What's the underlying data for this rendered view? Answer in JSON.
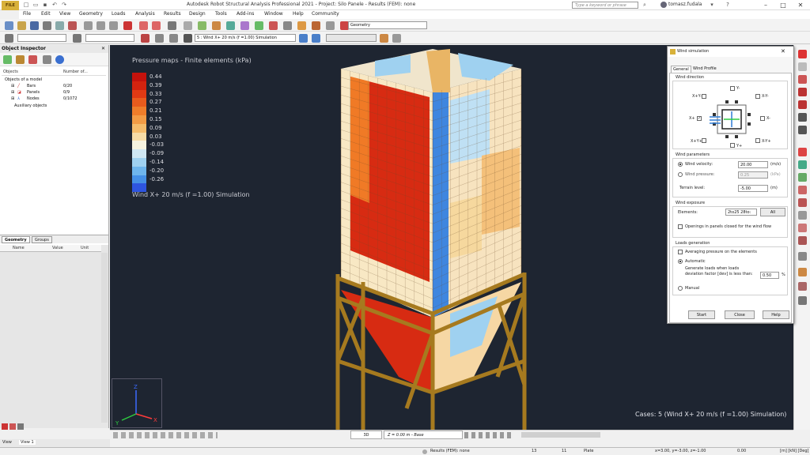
{
  "app": {
    "icon_label": "FILE",
    "title": "Autodesk Robot Structural Analysis Professional 2021 - Project: Silo Panele - Results (FEM): none",
    "search_placeholder": "Type a keyword or phrase",
    "user": "tomasz.fudala"
  },
  "menu": [
    "File",
    "Edit",
    "View",
    "Geometry",
    "Loads",
    "Analysis",
    "Results",
    "Design",
    "Tools",
    "Add-ins",
    "Window",
    "Help",
    "Community"
  ],
  "toolbar": {
    "case_select": "5 : Wind X+ 20 m/s (f =1.00) Simulation",
    "layout_select": "Geometry"
  },
  "inspector": {
    "title": "Object Inspector",
    "columns": [
      "Objects",
      "Number of..."
    ],
    "root": "Objects of a model",
    "items": [
      {
        "label": "Bars",
        "count": "0/20"
      },
      {
        "label": "Panels",
        "count": "0/9"
      },
      {
        "label": "Nodes",
        "count": "0/1072"
      }
    ],
    "auxiliary": "Auxiliary objects",
    "tabs": [
      "Geometry",
      "Groups"
    ]
  },
  "properties": {
    "columns": [
      "Name",
      "Value",
      "Unit"
    ]
  },
  "viewport": {
    "legend_title": "Pressure maps - Finite elements (kPa)",
    "legend": [
      {
        "value": "0.44",
        "color": "#c4120c"
      },
      {
        "value": "0.39",
        "color": "#d3230f"
      },
      {
        "value": "0.33",
        "color": "#e03a14"
      },
      {
        "value": "0.27",
        "color": "#e85b1d"
      },
      {
        "value": "0.21",
        "color": "#ef7d2a"
      },
      {
        "value": "0.15",
        "color": "#f39c45"
      },
      {
        "value": "0.09",
        "color": "#f6bd6c"
      },
      {
        "value": "0.03",
        "color": "#f7dca6"
      },
      {
        "value": "-0.03",
        "color": "#f6f3df"
      },
      {
        "value": "-0.09",
        "color": "#cfe7f3"
      },
      {
        "value": "-0.14",
        "color": "#9fd1f0"
      },
      {
        "value": "-0.20",
        "color": "#6eb5ec"
      },
      {
        "value": "-0.26",
        "color": "#4590e6"
      },
      {
        "value": "",
        "color": "#2e55e0"
      }
    ],
    "simulation_label": "Wind X+ 20 m/s (f =1.00) Simulation",
    "cases_label": "Cases: 5 (Wind X+ 20 m/s (f =1.00) Simulation)",
    "axes": {
      "x": "X",
      "y": "Y",
      "z": "Z"
    }
  },
  "dialog": {
    "title": "Wind simulation",
    "tabs": [
      "General",
      "Wind Profile"
    ],
    "direction": {
      "group": "Wind direction",
      "labels": [
        "Y-",
        "X+Y-",
        "X-Y-",
        "X+",
        "X-",
        "X+Y+",
        "X-Y+",
        "Y+"
      ],
      "checked": "X+"
    },
    "parameters": {
      "group": "Wind parameters",
      "velocity_label": "Wind velocity:",
      "velocity_value": "20.00",
      "velocity_unit": "(m/s)",
      "pressure_label": "Wind pressure:",
      "pressure_value": "0.25",
      "pressure_unit": "(kPa)",
      "terrain_label": "Terrain level:",
      "terrain_value": "-5.00",
      "terrain_unit": "(m)"
    },
    "exposure": {
      "group": "Wind exposure",
      "elements_label": "Elements:",
      "elements_value": "2to25 28to:",
      "all_button": "All",
      "openings_label": "Openings in panels closed for the wind flow"
    },
    "generation": {
      "group": "Loads generation",
      "averaging_label": "Averaging pressure on the elements",
      "automatic_label": "Automatic",
      "hint_line1": "Generate loads when loads",
      "hint_line2": "deviation factor [dev] is less than:",
      "deviation_value": "0.50",
      "deviation_unit": "%",
      "manual_label": "Manual"
    },
    "buttons": {
      "start": "Start",
      "close": "Close",
      "help": "Help"
    }
  },
  "bottom": {
    "mode": "3D",
    "level": "Z = 0.00 m - Base"
  },
  "viewtabs": [
    "View",
    "View 1"
  ],
  "status": {
    "results": "Results (FEM): none",
    "num1": "13",
    "num2": "11",
    "element_type": "Plate",
    "coords": "x=3.00, y=-3.00, z=-1.00",
    "angle": "0.00",
    "units": "[m] [kN] [Deg]"
  },
  "colors": {
    "viewport_bg": "#1e2531",
    "frame": "#a67a1f",
    "accent_blue": "#2f7cd6"
  }
}
